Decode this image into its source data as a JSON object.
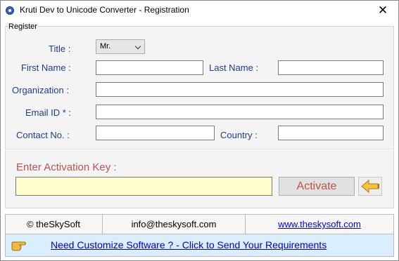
{
  "window": {
    "title": "Kruti Dev to Unicode Converter - Registration",
    "close_glyph": "✕"
  },
  "form": {
    "legend": "Register",
    "title_label": "Title :",
    "title_selected": "Mr.",
    "first_name_label": "First Name :",
    "first_name_value": "",
    "last_name_label": "Last Name :",
    "last_name_value": "",
    "organization_label": "Organization :",
    "organization_value": "",
    "email_label": "Email ID * :",
    "email_value": "",
    "contact_label": "Contact No. :",
    "contact_value": "",
    "country_label": "Country :",
    "country_value": ""
  },
  "activation": {
    "label": "Enter Activation Key  :",
    "key_value": "",
    "button_label": "Activate"
  },
  "footer": {
    "copyright": "© theSkySoft",
    "email": "info@theskysoft.com",
    "website": "www.theskysoft.com",
    "cta": "Need Customize Software ? - Click to Send Your Requirements"
  },
  "colors": {
    "label_blue": "#1f3d82",
    "activation_red": "#c0504d",
    "key_input_bg": "#ffffcc",
    "cta_bg": "#d9efff",
    "link_blue": "#0000ee"
  },
  "icons": {
    "app": "app-icon",
    "back_arrow": "arrow-left-icon",
    "pointing_hand": "pointing-hand-icon"
  }
}
